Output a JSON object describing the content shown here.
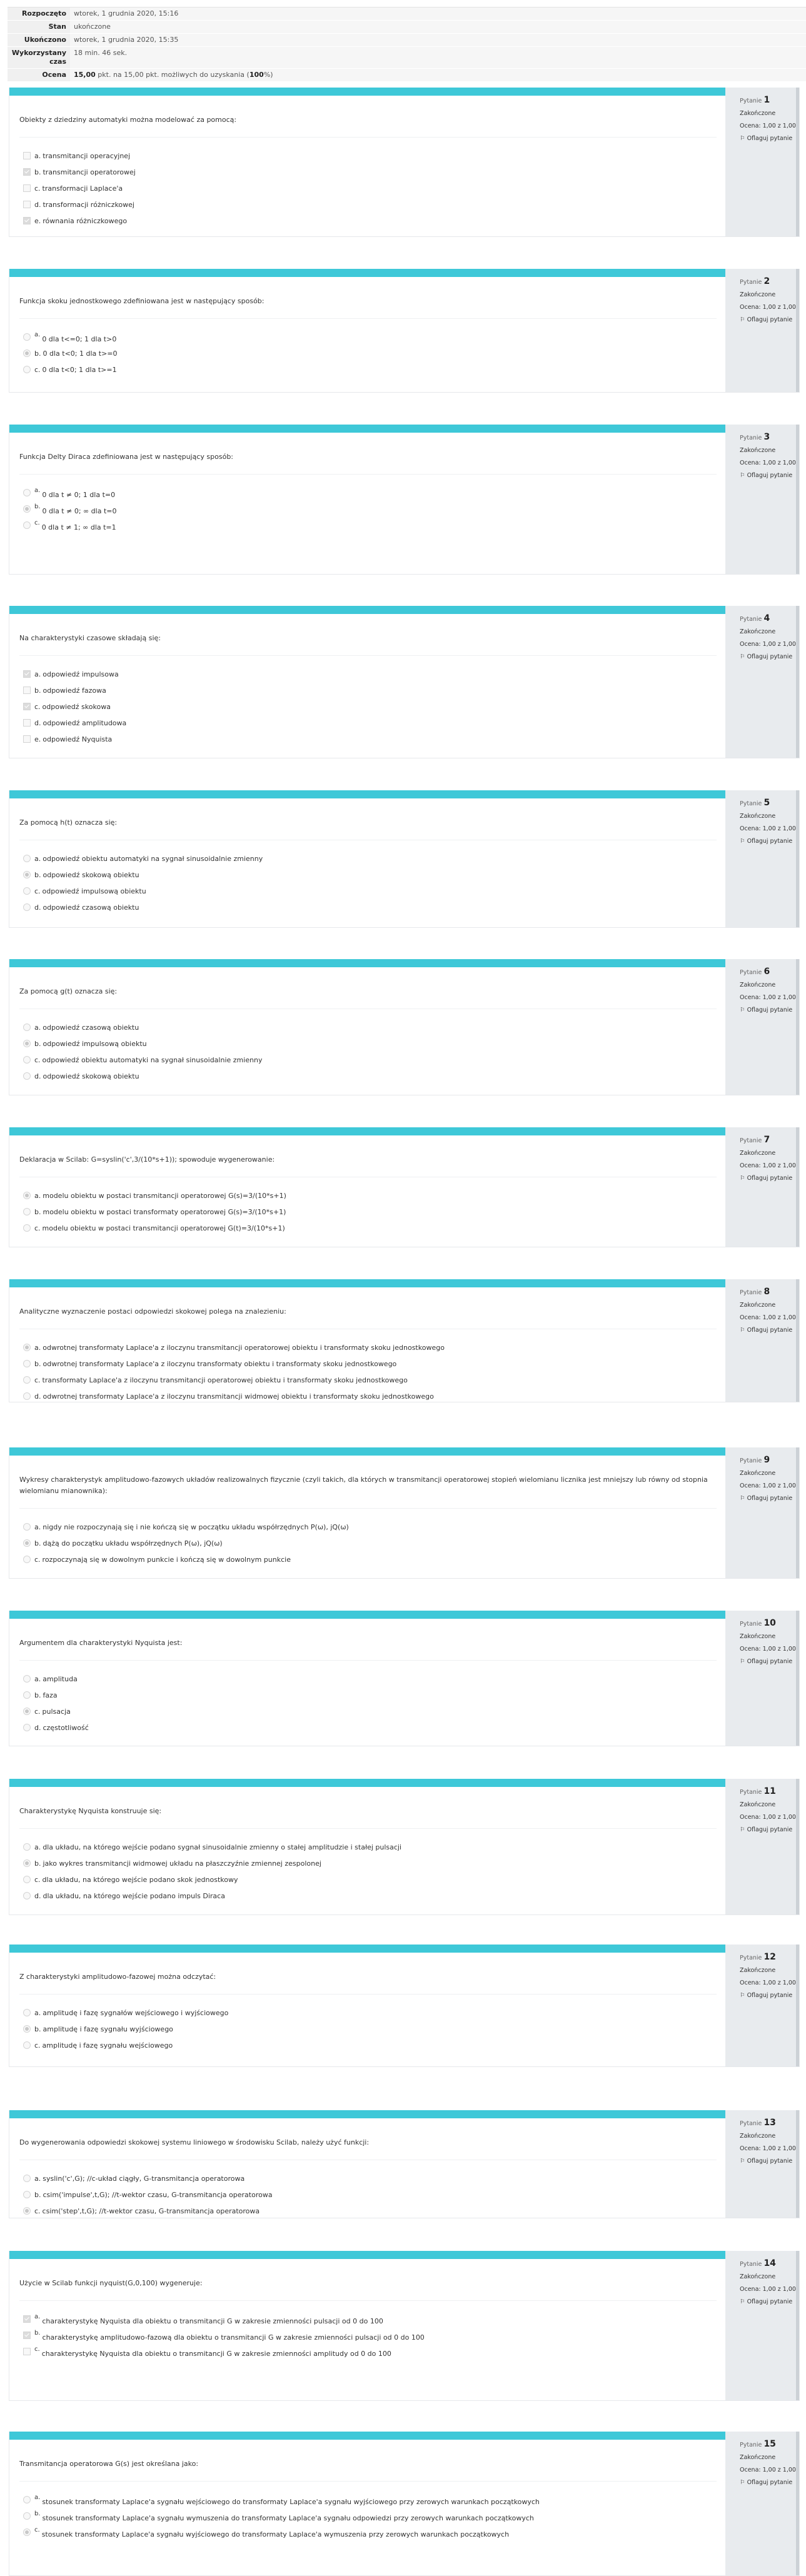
{
  "summary": [
    {
      "label": "Rozpoczęto",
      "value": "wtorek, 1 grudnia 2020, 15:16"
    },
    {
      "label": "Stan",
      "value": "ukończone"
    },
    {
      "label": "Ukończono",
      "value": "wtorek, 1 grudnia 2020, 15:35"
    },
    {
      "label": "Wykorzystany czas",
      "value": "18 min. 46 sek."
    }
  ],
  "grade": {
    "label": "Ocena",
    "points": "15,00",
    "middle": " pkt. na 15,00 pkt. możliwych do uzyskania (",
    "percent": "100",
    "end": "%)"
  },
  "question_info": {
    "number_label": "Pytanie",
    "state": "Zakończone",
    "mark": "Ocena: 1,00 z 1,00",
    "flag": "Oflaguj pytanie",
    "flag_icon": "flag-icon"
  },
  "colors": {
    "accent": "#3ec8d8",
    "info_bg": "#e8ebee"
  },
  "questions": [
    {
      "number": "1",
      "type": "checkbox",
      "text": "Obiekty z dziedziny automatyki można modelować za pomocą:",
      "options": [
        {
          "letter": "a.",
          "text": "transmitancji operacyjnej",
          "selected": false
        },
        {
          "letter": "b.",
          "text": "transmitancji operatorowej",
          "selected": true
        },
        {
          "letter": "c.",
          "text": "transformacji Laplace'a",
          "selected": false
        },
        {
          "letter": "d.",
          "text": "transformacji różniczkowej",
          "selected": false
        },
        {
          "letter": "e.",
          "text": "równania różniczkowego",
          "selected": true
        }
      ]
    },
    {
      "number": "2",
      "type": "radio",
      "text": "Funkcja skoku jednostkowego zdefiniowana jest w następujący sposób:",
      "options": [
        {
          "letter": "a.",
          "text": "0 dla t<=0; 1 dla t>0",
          "selected": false,
          "raised": true
        },
        {
          "letter": "b.",
          "text": "0 dla t<0; 1 dla t>=0",
          "selected": true
        },
        {
          "letter": "c.",
          "text": "0 dla t<0; 1 dla t>=1",
          "selected": false
        }
      ]
    },
    {
      "number": "3",
      "type": "radio",
      "text": "Funkcja Delty Diraca zdefiniowana jest w następujący sposób:",
      "options": [
        {
          "letter": "a.",
          "text": "0 dla t ≠ 0; 1 dla t=0",
          "selected": false,
          "raised": true
        },
        {
          "letter": "b.",
          "text": "0 dla t ≠ 0; ∞ dla t=0",
          "selected": true,
          "raised": true
        },
        {
          "letter": "c.",
          "text": "0 dla t ≠ 1; ∞ dla t=1",
          "selected": false,
          "raised": true
        }
      ]
    },
    {
      "number": "4",
      "type": "checkbox",
      "text": "Na charakterystyki czasowe składają się:",
      "options": [
        {
          "letter": "a.",
          "text": "odpowiedź impulsowa",
          "selected": true
        },
        {
          "letter": "b.",
          "text": "odpowiedź fazowa",
          "selected": false
        },
        {
          "letter": "c.",
          "text": "odpowiedź skokowa",
          "selected": true
        },
        {
          "letter": "d.",
          "text": "odpowiedź amplitudowa",
          "selected": false
        },
        {
          "letter": "e.",
          "text": "odpowiedź Nyquista",
          "selected": false
        }
      ]
    },
    {
      "number": "5",
      "type": "radio",
      "text": "Za pomocą h(t) oznacza się:",
      "options": [
        {
          "letter": "a.",
          "text": "odpowiedź obiektu automatyki na sygnał sinusoidalnie zmienny",
          "selected": false
        },
        {
          "letter": "b.",
          "text": "odpowiedź skokową obiektu",
          "selected": true
        },
        {
          "letter": "c.",
          "text": "odpowiedź impulsową obiektu",
          "selected": false
        },
        {
          "letter": "d.",
          "text": "odpowiedź czasową obiektu",
          "selected": false
        }
      ]
    },
    {
      "number": "6",
      "type": "radio",
      "text": "Za pomocą g(t) oznacza się:",
      "options": [
        {
          "letter": "a.",
          "text": "odpowiedź czasową obiektu",
          "selected": false
        },
        {
          "letter": "b.",
          "text": "odpowiedź impulsową obiektu",
          "selected": true
        },
        {
          "letter": "c.",
          "text": "odpowiedź obiektu automatyki na sygnał sinusoidalnie zmienny",
          "selected": false
        },
        {
          "letter": "d.",
          "text": "odpowiedź skokową obiektu",
          "selected": false
        }
      ]
    },
    {
      "number": "7",
      "type": "radio",
      "text": "Deklaracja w Scilab: G=syslin('c',3/(10*s+1)); spowoduje wygenerowanie:",
      "options": [
        {
          "letter": "a.",
          "text": "modelu obiektu w postaci transmitancji operatorowej G(s)=3/(10*s+1)",
          "selected": true
        },
        {
          "letter": "b.",
          "text": "modelu obiektu w postaci transformaty operatorowej G(s)=3/(10*s+1)",
          "selected": false
        },
        {
          "letter": "c.",
          "text": "modelu obiektu w postaci transmitancji operatorowej G(t)=3/(10*s+1)",
          "selected": false
        }
      ]
    },
    {
      "number": "8",
      "type": "radio",
      "text": "Analityczne wyznaczenie postaci odpowiedzi skokowej polega na znalezieniu:",
      "options": [
        {
          "letter": "a.",
          "text": "odwrotnej transformaty Laplace'a z iloczynu transmitancji operatorowej obiektu i transformaty skoku jednostkowego",
          "selected": true
        },
        {
          "letter": "b.",
          "text": "odwrotnej transformaty Laplace'a z iloczynu transformaty obiektu i transformaty skoku jednostkowego",
          "selected": false
        },
        {
          "letter": "c.",
          "text": "transformaty Laplace'a z iloczynu transmitancji operatorowej obiektu i transformaty skoku jednostkowego",
          "selected": false
        },
        {
          "letter": "d.",
          "text": "odwrotnej transformaty Laplace'a z iloczynu transmitancji widmowej obiektu i transformaty skoku jednostkowego",
          "selected": false
        }
      ]
    },
    {
      "number": "9",
      "type": "radio",
      "text": "Wykresy charakterystyk amplitudowo-fazowych układów realizowalnych fizycznie (czyli takich, dla których w transmitancji operatorowej stopień wielomianu licznika jest mniejszy lub równy od stopnia wielomianu mianownika):",
      "options": [
        {
          "letter": "a.",
          "text": "nigdy nie rozpoczynają się i nie kończą się w początku układu współrzędnych P(ω), jQ(ω)",
          "selected": false
        },
        {
          "letter": "b.",
          "text": "dążą do początku układu współrzędnych P(ω), jQ(ω)",
          "selected": true
        },
        {
          "letter": "c.",
          "text": "rozpoczynają się w dowolnym punkcie i kończą się w dowolnym punkcie",
          "selected": false
        }
      ]
    },
    {
      "number": "10",
      "type": "radio",
      "text": "Argumentem dla charakterystyki Nyquista jest:",
      "options": [
        {
          "letter": "a.",
          "text": "amplituda",
          "selected": false
        },
        {
          "letter": "b.",
          "text": "faza",
          "selected": false
        },
        {
          "letter": "c.",
          "text": "pulsacja",
          "selected": true
        },
        {
          "letter": "d.",
          "text": "częstotliwość",
          "selected": false
        }
      ]
    },
    {
      "number": "11",
      "type": "radio",
      "text": "Charakterystykę Nyquista konstruuje się:",
      "options": [
        {
          "letter": "a.",
          "text": "dla układu, na którego wejście podano sygnał sinusoidalnie zmienny o stałej amplitudzie i stałej pulsacji",
          "selected": false
        },
        {
          "letter": "b.",
          "text": "jako wykres transmitancji widmowej układu na płaszczyźnie zmiennej zespolonej",
          "selected": true
        },
        {
          "letter": "c.",
          "text": "dla układu, na którego wejście podano skok jednostkowy",
          "selected": false
        },
        {
          "letter": "d.",
          "text": "dla układu, na którego wejście podano impuls Diraca",
          "selected": false
        }
      ]
    },
    {
      "number": "12",
      "type": "radio",
      "text": "Z charakterystyki amplitudowo-fazowej można odczytać:",
      "options": [
        {
          "letter": "a.",
          "text": "amplitudę i fazę sygnałów wejściowego i wyjściowego",
          "selected": false
        },
        {
          "letter": "b.",
          "text": "amplitudę i fazę sygnału wyjściowego",
          "selected": true
        },
        {
          "letter": "c.",
          "text": "amplitudę i fazę sygnału wejściowego",
          "selected": false
        }
      ]
    },
    {
      "number": "13",
      "type": "radio",
      "text": "Do wygenerowania odpowiedzi skokowej systemu liniowego w środowisku Scilab, należy użyć funkcji:",
      "options": [
        {
          "letter": "a.",
          "text": "syslin('c',G); //c-układ ciągły, G-transmitancja operatorowa",
          "selected": false
        },
        {
          "letter": "b.",
          "text": "csim('impulse',t,G); //t-wektor czasu, G-transmitancja operatorowa",
          "selected": false
        },
        {
          "letter": "c.",
          "text": "csim('step',t,G); //t-wektor czasu, G-transmitancja operatorowa",
          "selected": true
        }
      ]
    },
    {
      "number": "14",
      "type": "checkbox",
      "text": "Użycie w Scilab funkcji nyquist(G,0,100) wygeneruje:",
      "options": [
        {
          "letter": "a.",
          "text": "charakterystykę Nyquista dla obiektu o transmitancji G w zakresie zmienności pulsacji od 0 do 100",
          "selected": true,
          "raised": true
        },
        {
          "letter": "b.",
          "text": "charakterystykę amplitudowo-fazową dla obiektu o transmitancji G w zakresie zmienności pulsacji od 0 do 100",
          "selected": true,
          "raised": true
        },
        {
          "letter": "c.",
          "text": "charakterystykę Nyquista dla obiektu o transmitancji G w zakresie zmienności amplitudy od 0 do 100",
          "selected": false,
          "raised": true
        }
      ]
    },
    {
      "number": "15",
      "type": "radio",
      "text": "Transmitancja operatorowa G(s) jest określana jako:",
      "options": [
        {
          "letter": "a.",
          "text": "stosunek transformaty Laplace'a sygnału wejściowego do transformaty Laplace'a sygnału wyjściowego przy zerowych warunkach początkowych",
          "selected": false,
          "raised": true
        },
        {
          "letter": "b.",
          "text": "stosunek transformaty Laplace'a sygnału wymuszenia do transformaty Laplace'a sygnału odpowiedzi przy zerowych warunkach początkowych",
          "selected": false,
          "raised": true
        },
        {
          "letter": "c.",
          "text": "stosunek transformaty Laplace'a sygnału wyjściowego do transformaty Laplace'a wymuszenia przy zerowych warunkach początkowych",
          "selected": true,
          "raised": true
        }
      ]
    }
  ]
}
